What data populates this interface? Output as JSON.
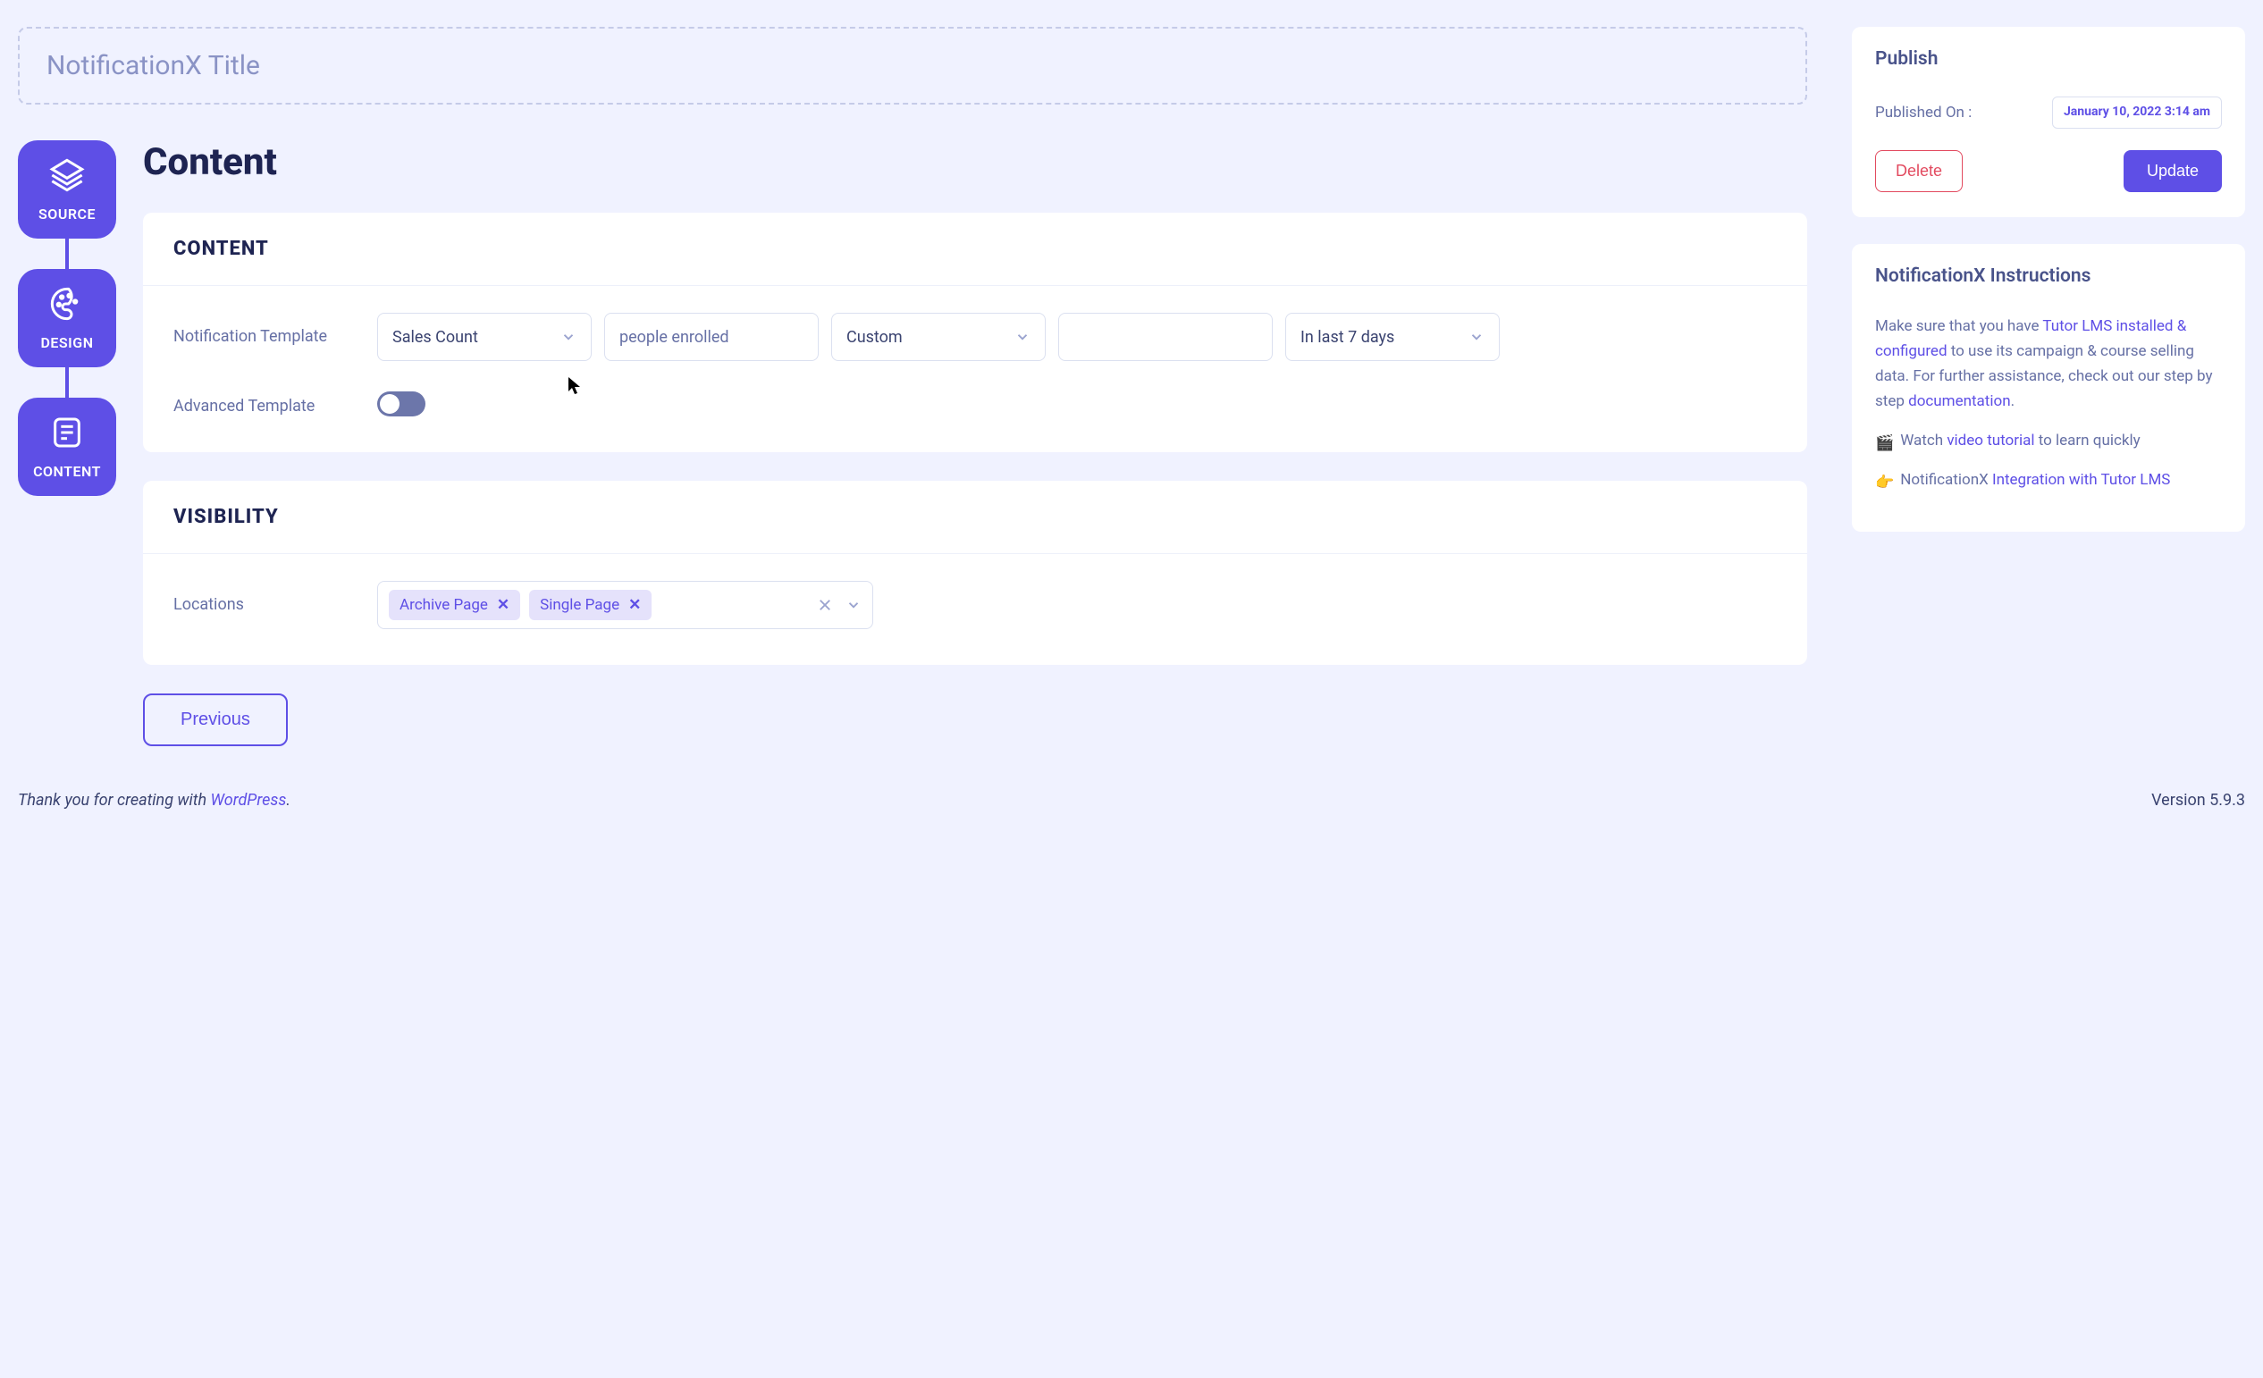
{
  "title_placeholder": "NotificationX Title",
  "stepper": [
    {
      "label": "SOURCE"
    },
    {
      "label": "DESIGN"
    },
    {
      "label": "CONTENT"
    }
  ],
  "page_heading": "Content",
  "content_card": {
    "header": "CONTENT",
    "template_label": "Notification Template",
    "select1": "Sales Count",
    "input1": "people enrolled",
    "select2": "Custom",
    "input2": "",
    "select3": "In last 7 days",
    "advanced_label": "Advanced Template"
  },
  "visibility_card": {
    "header": "VISIBILITY",
    "locations_label": "Locations",
    "tags": [
      "Archive Page",
      "Single Page"
    ]
  },
  "previous_btn": "Previous",
  "publish": {
    "title": "Publish",
    "published_on_label": "Published On :",
    "date": "January 10, 2022 3:14 am",
    "delete": "Delete",
    "update": "Update"
  },
  "instructions": {
    "title": "NotificationX Instructions",
    "p1_prefix": "Make sure that you have ",
    "p1_link1": "Tutor LMS installed & configured",
    "p1_mid": " to use its campaign & course selling data. For further assistance, check out our step by step ",
    "p1_link2": "documentation",
    "p1_suffix": ".",
    "p2_prefix": " Watch ",
    "p2_link": "video tutorial",
    "p2_suffix": " to learn quickly",
    "p3_prefix": " NotificationX ",
    "p3_link": "Integration with Tutor LMS"
  },
  "footer": {
    "thanks_prefix": "Thank you for creating with ",
    "thanks_link": "WordPress",
    "thanks_suffix": ".",
    "version": "Version 5.9.3"
  }
}
